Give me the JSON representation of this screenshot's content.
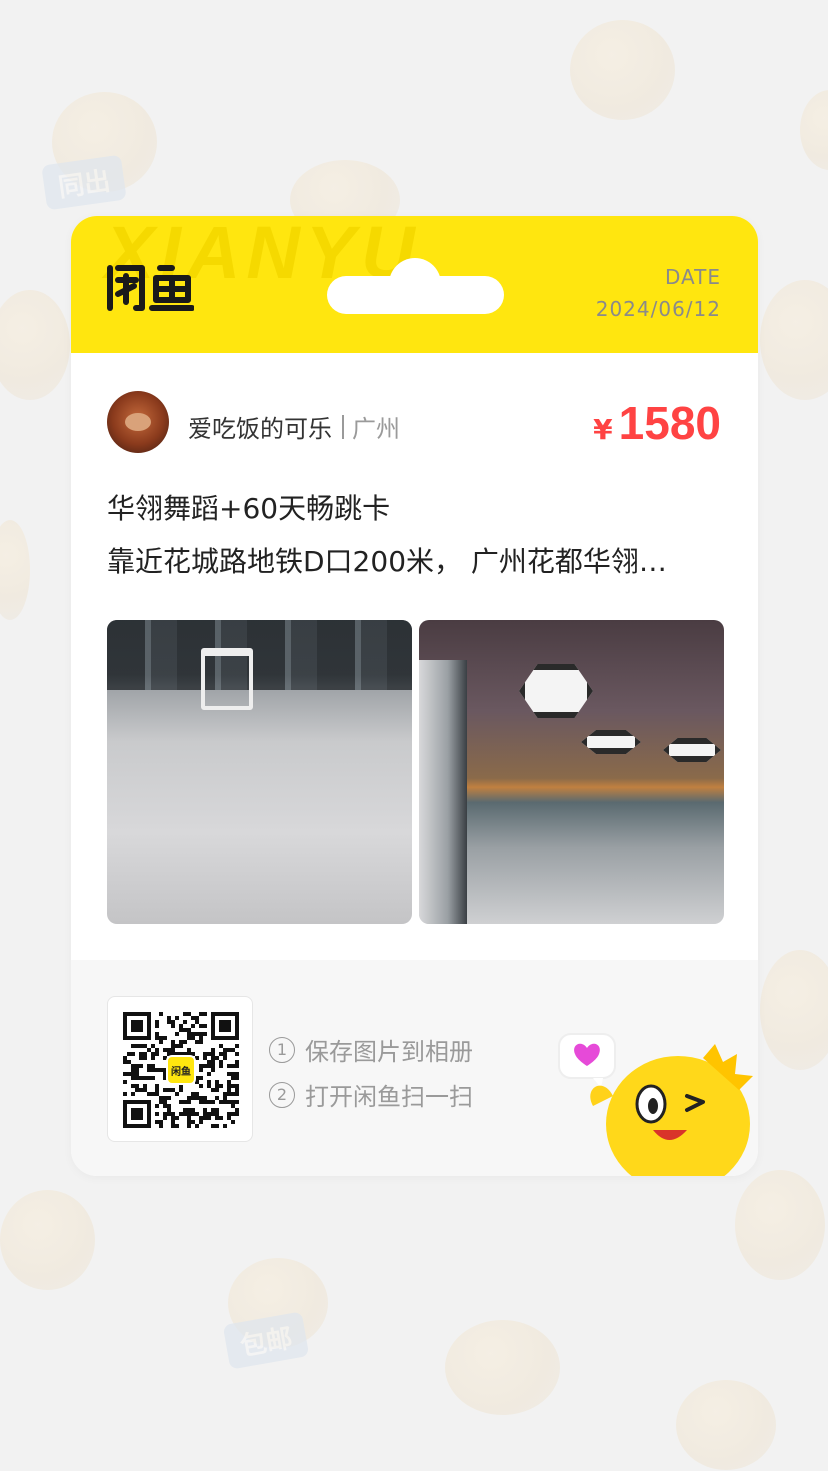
{
  "header": {
    "logo_text": "闲鱼",
    "watermark": "XIANYU",
    "date_label": "DATE",
    "date_value": "2024/06/12"
  },
  "seller": {
    "name": "爱吃饭的可乐",
    "city": "广州"
  },
  "price": {
    "symbol": "¥",
    "amount": "1580"
  },
  "listing": {
    "title": "华翎舞蹈+60天畅跳卡",
    "description": "靠近花城路地铁D口200米， 广州花都华翎…"
  },
  "photos": [
    {
      "name": "dance-studio-floor-photo"
    },
    {
      "name": "dance-studio-hall-photo"
    }
  ],
  "footer": {
    "qr_logo_text": "闲鱼",
    "steps": [
      {
        "num": "1",
        "text": "保存图片到相册"
      },
      {
        "num": "2",
        "text": "打开闲鱼扫一扫"
      }
    ]
  },
  "background_tags": [
    "同出",
    "包邮"
  ],
  "colors": {
    "brand_yellow": "#ffe60f",
    "price_red": "#ff4343",
    "background": "#f2f2f2"
  }
}
